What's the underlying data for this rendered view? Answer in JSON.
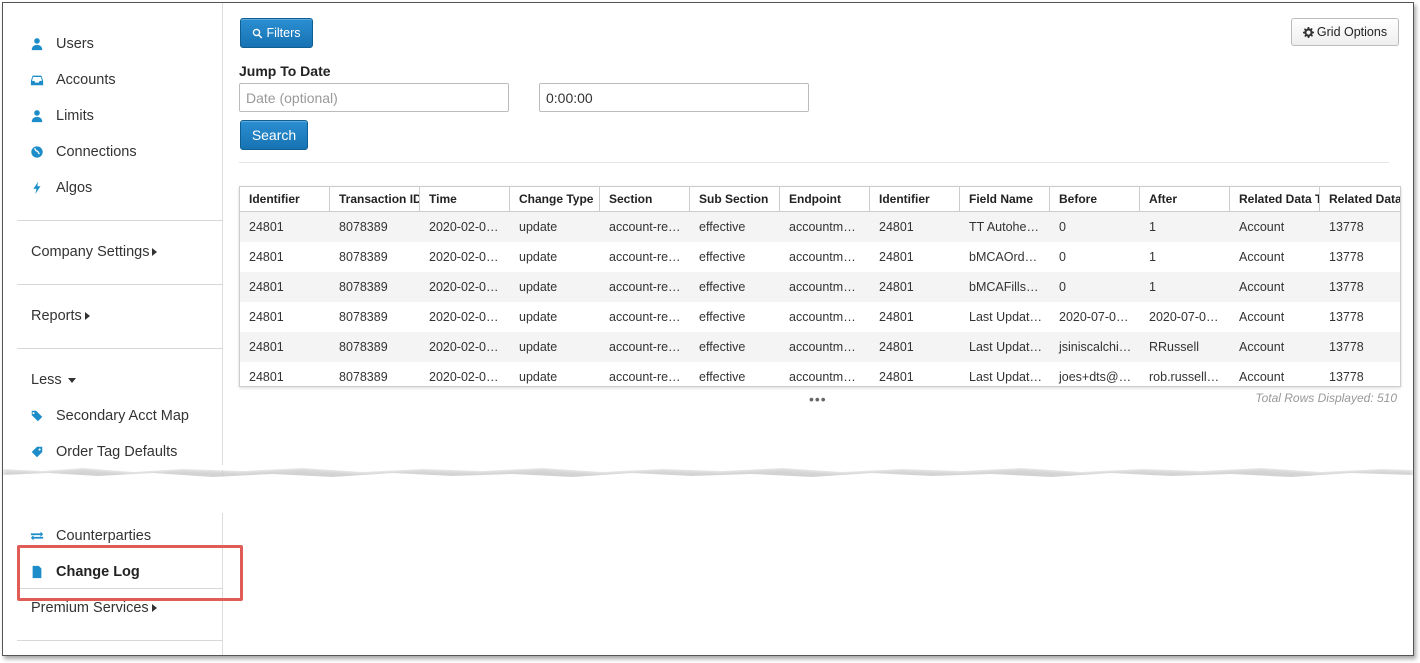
{
  "sidebar": {
    "top_items": [
      {
        "label": "Users",
        "icon": "user-icon"
      },
      {
        "label": "Accounts",
        "icon": "inbox-icon"
      },
      {
        "label": "Limits",
        "icon": "user-icon"
      },
      {
        "label": "Connections",
        "icon": "globe-icon"
      },
      {
        "label": "Algos",
        "icon": "bolt-icon"
      }
    ],
    "company_settings": "Company Settings",
    "reports": "Reports",
    "less": "Less",
    "more_items": [
      {
        "label": "Secondary Acct Map",
        "icon": "tags-icon"
      },
      {
        "label": "Order Tag Defaults",
        "icon": "tag-icon"
      }
    ],
    "bottom_items": [
      {
        "label": "Counterparties",
        "icon": "exchange-icon"
      },
      {
        "label": "Change Log",
        "icon": "file-icon",
        "active": true
      }
    ],
    "premium_services": "Premium Services",
    "accent_color": "#1c8dc9",
    "highlight_color": "#e05d57"
  },
  "toolbar": {
    "filters_label": "Filters",
    "grid_options_label": "Grid Options"
  },
  "jump_to_date": {
    "heading": "Jump To Date",
    "date_placeholder": "Date (optional)",
    "time_value": "0:00:00",
    "search_label": "Search"
  },
  "grid": {
    "columns": [
      "Identifier",
      "Transaction ID",
      "Time",
      "Change Type",
      "Section",
      "Sub Section",
      "Endpoint",
      "Identifier",
      "Field Name",
      "Before",
      "After",
      "Related Data Ty",
      "Related Data"
    ],
    "rows": [
      [
        "24801",
        "8078389",
        "2020-02-0…",
        "update",
        "account-re…",
        "effective",
        "accountm…",
        "24801",
        "TT Autohe…",
        "0",
        "1",
        "Account",
        "13778"
      ],
      [
        "24801",
        "8078389",
        "2020-02-0…",
        "update",
        "account-re…",
        "effective",
        "accountm…",
        "24801",
        "bMCAOrd…",
        "0",
        "1",
        "Account",
        "13778"
      ],
      [
        "24801",
        "8078389",
        "2020-02-0…",
        "update",
        "account-re…",
        "effective",
        "accountm…",
        "24801",
        "bMCAFills…",
        "0",
        "1",
        "Account",
        "13778"
      ],
      [
        "24801",
        "8078389",
        "2020-02-0…",
        "update",
        "account-re…",
        "effective",
        "accountm…",
        "24801",
        "Last Updat…",
        "2020-07-0…",
        "2020-07-0…",
        "Account",
        "13778"
      ],
      [
        "24801",
        "8078389",
        "2020-02-0…",
        "update",
        "account-re…",
        "effective",
        "accountm…",
        "24801",
        "Last Updat…",
        "jsiniscalchi…",
        "RRussell",
        "Account",
        "13778"
      ],
      [
        "24801",
        "8078389",
        "2020-02-0…",
        "update",
        "account-re…",
        "effective",
        "accountm…",
        "24801",
        "Last Updat…",
        "joes+dts@…",
        "rob.russell…",
        "Account",
        "13778"
      ]
    ],
    "more_indicator": "•••",
    "total_rows": "Total Rows Displayed: 510"
  }
}
